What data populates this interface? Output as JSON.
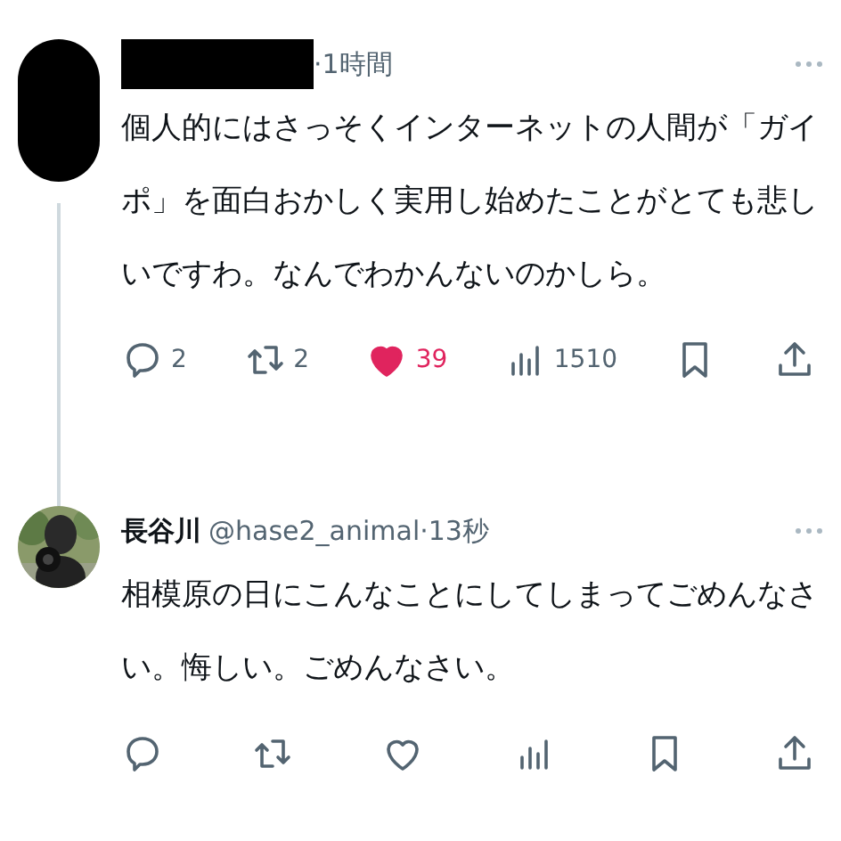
{
  "posts": [
    {
      "avatar": {
        "kind": "plain"
      },
      "name_redacted": true,
      "time": "·1時間",
      "text": "個人的にはさっそくインターネットの人間が「ガイポ」を面白おかしく実用し始めたことがとても悲しいですわ。なんでわかんないのかしら。",
      "thread_line": true,
      "actions": [
        {
          "kind": "reply",
          "count": "2"
        },
        {
          "kind": "repost",
          "count": "2"
        },
        {
          "kind": "like",
          "count": "39",
          "selected": true
        },
        {
          "kind": "views",
          "count": "1510"
        },
        {
          "kind": "bookmark"
        },
        {
          "kind": "share"
        }
      ]
    },
    {
      "name": "長谷川",
      "handle": "@hase2_animal",
      "time": "·13秒",
      "text": "相模原の日にこんなことにしてしまってごめんなさい。悔しい。ごめんなさい。",
      "thread_line": false,
      "actions": [
        {
          "kind": "reply"
        },
        {
          "kind": "repost"
        },
        {
          "kind": "like",
          "selected": false
        },
        {
          "kind": "views"
        },
        {
          "kind": "bookmark"
        },
        {
          "kind": "share"
        }
      ]
    }
  ]
}
